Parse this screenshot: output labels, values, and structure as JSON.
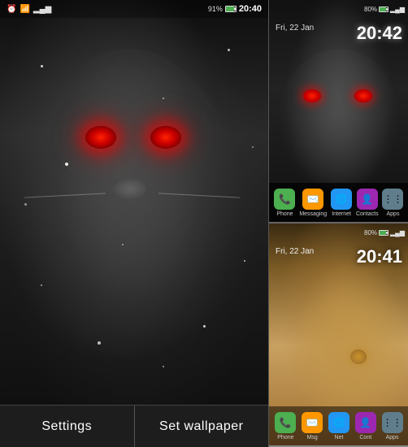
{
  "left_panel": {
    "status": {
      "time": "20:40",
      "battery": "91%",
      "signal_bars": "▂▄▆█",
      "wifi": "WiFi"
    },
    "lion": {
      "description": "Dark lion face with glowing red eyes"
    },
    "buttons": {
      "settings_label": "Settings",
      "wallpaper_label": "Set wallpaper"
    }
  },
  "right_panel": {
    "phone_top": {
      "date": "Fri, 22 Jan",
      "time": "20:42",
      "battery": "80%",
      "dock": [
        {
          "label": "Phone",
          "color": "#4CAF50"
        },
        {
          "label": "Messaging",
          "color": "#FF9800"
        },
        {
          "label": "Internet",
          "color": "#2196F3"
        },
        {
          "label": "Contacts",
          "color": "#9C27B0"
        },
        {
          "label": "Apps",
          "color": "#607D8B"
        }
      ]
    },
    "phone_bottom": {
      "date": "Fri, 22 Jan",
      "time": "20:41",
      "battery": "80%",
      "description": "Brown lion face"
    }
  }
}
